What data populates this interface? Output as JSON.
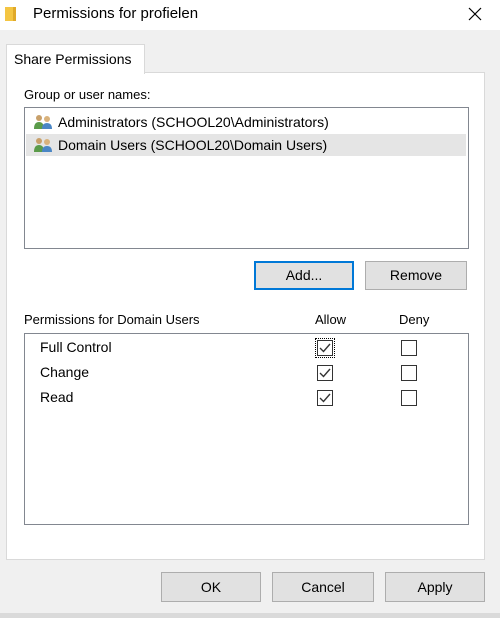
{
  "window": {
    "title": "Permissions for profielen",
    "close_glyph": "✕"
  },
  "tabs": [
    {
      "label": "Share Permissions",
      "active": true
    }
  ],
  "group_section": {
    "label": "Group or user names:",
    "items": [
      {
        "label": "Administrators (SCHOOL20\\Administrators)",
        "icon": "users-icon",
        "selected": false
      },
      {
        "label": "Domain Users (SCHOOL20\\Domain Users)",
        "icon": "users-icon",
        "selected": true
      }
    ],
    "add_label": "Add...",
    "remove_label": "Remove"
  },
  "permissions": {
    "header": "Permissions for Domain Users",
    "allow_header": "Allow",
    "deny_header": "Deny",
    "rows": [
      {
        "name": "Full Control",
        "allow": true,
        "deny": false
      },
      {
        "name": "Change",
        "allow": true,
        "deny": false
      },
      {
        "name": "Read",
        "allow": true,
        "deny": false
      }
    ]
  },
  "footer": {
    "ok_label": "OK",
    "cancel_label": "Cancel",
    "apply_label": "Apply"
  },
  "colors": {
    "accent": "#0078d7",
    "selection": "#e5e5e5",
    "folder": "#f4c542"
  }
}
